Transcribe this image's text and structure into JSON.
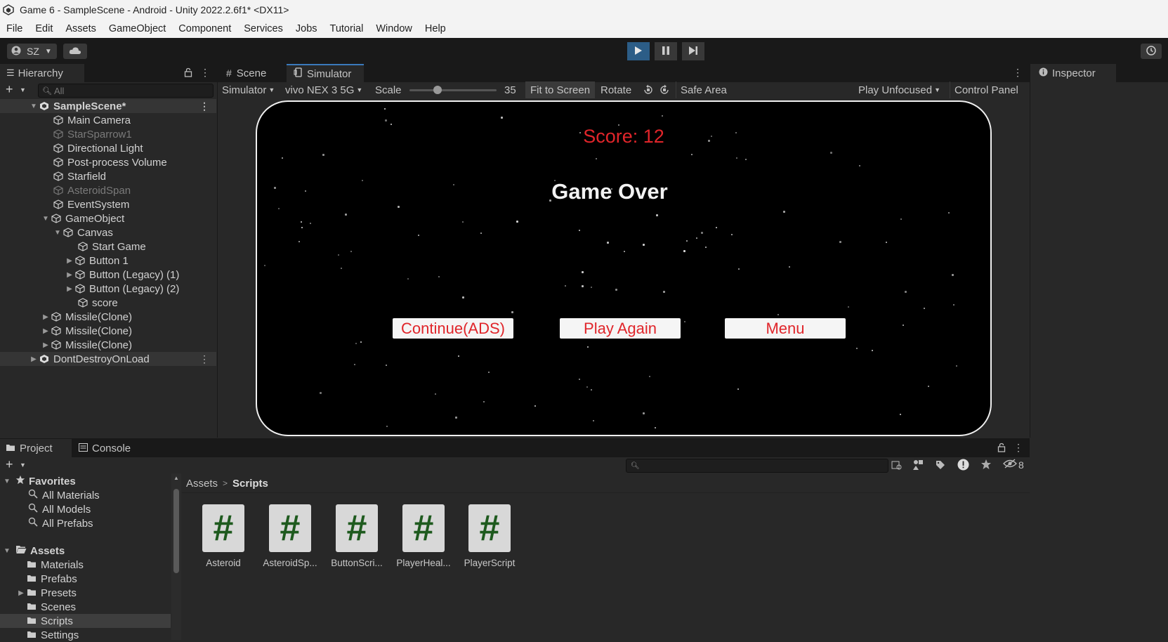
{
  "window": {
    "title": "Game 6 - SampleScene - Android - Unity 2022.2.6f1* <DX11>"
  },
  "menu": [
    "File",
    "Edit",
    "Assets",
    "GameObject",
    "Component",
    "Services",
    "Jobs",
    "Tutorial",
    "Window",
    "Help"
  ],
  "toolbar": {
    "account": "SZ"
  },
  "hierarchy": {
    "tab": "Hierarchy",
    "search_placeholder": "All",
    "items": [
      {
        "label": "SampleScene*"
      },
      {
        "label": "Main Camera"
      },
      {
        "label": "StarSparrow1"
      },
      {
        "label": "Directional Light"
      },
      {
        "label": "Post-process Volume"
      },
      {
        "label": "Starfield"
      },
      {
        "label": "AsteroidSpan"
      },
      {
        "label": "EventSystem"
      },
      {
        "label": "GameObject"
      },
      {
        "label": "Canvas"
      },
      {
        "label": "Start Game"
      },
      {
        "label": "Button 1"
      },
      {
        "label": "Button (Legacy) (1)"
      },
      {
        "label": "Button (Legacy) (2)"
      },
      {
        "label": "score"
      },
      {
        "label": "Missile(Clone)"
      },
      {
        "label": "Missile(Clone)"
      },
      {
        "label": "Missile(Clone)"
      },
      {
        "label": "DontDestroyOnLoad"
      }
    ]
  },
  "center_tabs": {
    "scene": "Scene",
    "simulator": "Simulator"
  },
  "sim_toolbar": {
    "mode": "Simulator",
    "device": "vivo NEX 3 5G",
    "scale_label": "Scale",
    "scale_value": "35",
    "scale_fraction": 0.3,
    "fit": "Fit to Screen",
    "rotate": "Rotate",
    "safe_area": "Safe Area",
    "play_mode": "Play Unfocused",
    "control_panel": "Control Panel"
  },
  "game": {
    "score": "Score: 12",
    "title": "Game Over",
    "buttons": {
      "continue": "Continue(ADS)",
      "play_again": "Play Again",
      "menu": "Menu"
    }
  },
  "inspector": {
    "tab": "Inspector"
  },
  "bottom_tabs": {
    "project": "Project",
    "console": "Console"
  },
  "project_tree": {
    "favorites": "Favorites",
    "fav_items": [
      "All Materials",
      "All Models",
      "All Prefabs"
    ],
    "assets": "Assets",
    "folders": [
      "Materials",
      "Prefabs",
      "Presets",
      "Scenes",
      "Scripts",
      "Settings"
    ]
  },
  "breadcrumb": {
    "root": "Assets",
    "current": "Scripts"
  },
  "hidden_count": "8",
  "scripts": [
    "Asteroid",
    "AsteroidSp...",
    "ButtonScri...",
    "PlayerHeal...",
    "PlayerScript"
  ],
  "script_glyph": "#",
  "colors": {
    "accent": "#2c5d87",
    "score_red": "#e0252a"
  }
}
